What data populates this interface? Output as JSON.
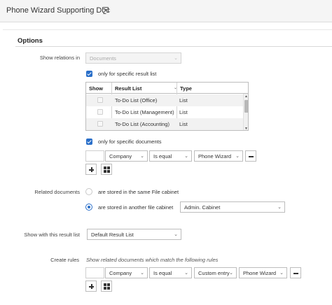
{
  "header": {
    "title": "Phone Wizard Supporting Doc",
    "comment_icon": "comment-icon"
  },
  "options": {
    "title": "Options",
    "show_relations": {
      "label": "Show relations in",
      "value": "Documents",
      "only_result_list_label": "only for specific result list",
      "only_result_list_checked": true,
      "table": {
        "columns": [
          "Show",
          "Result List",
          "Type"
        ],
        "rows": [
          {
            "show": false,
            "name": "To-Do List (Office)",
            "type": "List"
          },
          {
            "show": false,
            "name": "To-Do List (Management)",
            "type": "List"
          },
          {
            "show": false,
            "name": "To-Do List (Accounting)",
            "type": "List"
          }
        ]
      },
      "only_documents_label": "only for specific documents",
      "only_documents_checked": true,
      "filter": {
        "field": "Company",
        "operator": "Is equal",
        "value": "Phone Wizard"
      }
    },
    "related_documents": {
      "label": "Related documents",
      "option_same": "are stored in the same File cabinet",
      "option_other": "are stored in another file cabinet",
      "selected": "other",
      "cabinet": "Admin. Cabinet"
    },
    "result_list": {
      "label": "Show with this result list",
      "value": "Default Result List"
    },
    "create_rules": {
      "label": "Create rules",
      "hint": "Show related documents which match the following rules",
      "rule": {
        "field": "Company",
        "operator": "Is equal",
        "entry_type": "Custom entry",
        "value": "Phone Wizard"
      }
    }
  }
}
